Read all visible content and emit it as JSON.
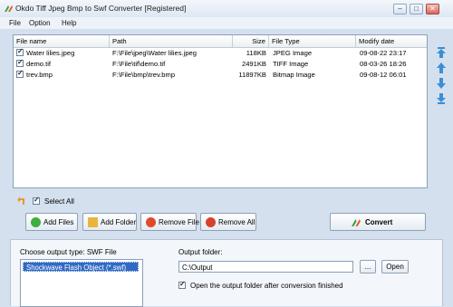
{
  "window": {
    "title": "Okdo Tiff Jpeg Bmp to Swf Converter [Registered]",
    "min_glyph": "–",
    "max_glyph": "□",
    "close_glyph": "✕"
  },
  "menu": [
    "File",
    "Option",
    "Help"
  ],
  "file_list": {
    "columns": [
      "File name",
      "Path",
      "Size",
      "File Type",
      "Modify date"
    ],
    "rows": [
      {
        "checked": true,
        "name": "Water lilies.jpeg",
        "path": "F:\\File\\jpeg\\Water lilies.jpeg",
        "size": "118KB",
        "type": "JPEG Image",
        "date": "09-08-22 23:17"
      },
      {
        "checked": true,
        "name": "demo.tif",
        "path": "F:\\File\\tif\\demo.tif",
        "size": "2491KB",
        "type": "TIFF Image",
        "date": "08-03-26 18:26"
      },
      {
        "checked": true,
        "name": "trev.bmp",
        "path": "F:\\File\\bmp\\trev.bmp",
        "size": "11897KB",
        "type": "Bitmap Image",
        "date": "09-08-12 06:01"
      }
    ]
  },
  "icons": {
    "move_top": "move-top-icon",
    "move_up": "arrow-up-icon",
    "move_down": "arrow-down-icon",
    "move_bottom": "move-bottom-icon",
    "back": "back-arrow-icon"
  },
  "select_all": {
    "label": "Select All",
    "checked": true
  },
  "buttons": {
    "add_files": "Add Files",
    "add_folder": "Add Folder",
    "remove_file": "Remove File",
    "remove_all": "Remove All",
    "convert": "Convert",
    "browse": "...",
    "open": "Open"
  },
  "output": {
    "type_label": "Choose output type:  SWF File",
    "types": [
      "Shockwave Flash Object (*.swf)"
    ],
    "folder_label": "Output folder:",
    "folder_value": "C:\\Output",
    "open_after_label": "Open the output folder after conversion finished",
    "open_after_checked": true
  },
  "colors": {
    "accent": "#316ac5",
    "window_bg": "#d4e0ee"
  }
}
